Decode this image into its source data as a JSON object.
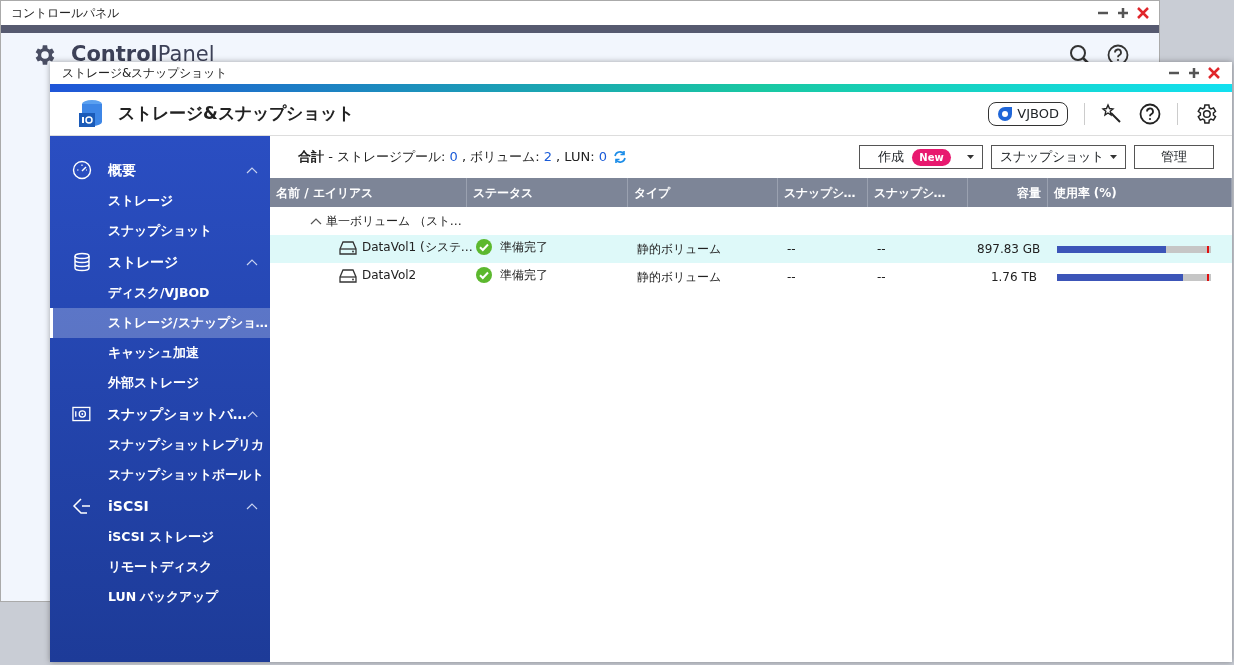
{
  "back_window": {
    "title": "コントロールパネル",
    "app_title_bold": "Control",
    "app_title_light": "Panel"
  },
  "window": {
    "title": "ストレージ&スナップショット",
    "app_title": "ストレージ&スナップショット",
    "vjbod_button": "VJBOD"
  },
  "sidebar": {
    "groups": [
      {
        "label": "概要",
        "kind": "gauge",
        "expanded": true,
        "items": [
          {
            "label": "ストレージ",
            "selected": false
          },
          {
            "label": "スナップショット",
            "selected": false
          }
        ]
      },
      {
        "label": "ストレージ",
        "kind": "database",
        "expanded": true,
        "items": [
          {
            "label": "ディスク/VJBOD",
            "selected": false
          },
          {
            "label": "ストレージ/スナップショ…",
            "selected": true
          },
          {
            "label": "キャッシュ加速",
            "selected": false
          },
          {
            "label": "外部ストレージ",
            "selected": false
          }
        ]
      },
      {
        "label": "スナップショットバ…",
        "kind": "camera",
        "expanded": true,
        "items": [
          {
            "label": "スナップショットレプリカ",
            "selected": false
          },
          {
            "label": "スナップショットボールト",
            "selected": false
          }
        ]
      },
      {
        "label": "iSCSI",
        "kind": "port",
        "expanded": true,
        "items": [
          {
            "label": "iSCSI ストレージ",
            "selected": false
          },
          {
            "label": "リモートディスク",
            "selected": false
          },
          {
            "label": "LUN バックアップ",
            "selected": false
          }
        ]
      }
    ]
  },
  "summary": {
    "label": "合計",
    "stats": [
      {
        "name": "- ストレージプール:",
        "value": "0"
      },
      {
        "name": ", ボリューム:",
        "value": "2"
      },
      {
        "name": ", LUN:",
        "value": "0"
      }
    ]
  },
  "toolbar": {
    "buttons": [
      {
        "label": "作成",
        "badge": "New",
        "dropdown": true
      },
      {
        "label": "スナップショット",
        "dropdown": true
      },
      {
        "label": "管理",
        "dropdown": false
      }
    ]
  },
  "table": {
    "columns": [
      "名前 / エイリアス",
      "ステータス",
      "タイプ",
      "スナップシ…",
      "スナップシ…",
      "容量",
      "使用率 (%)"
    ],
    "groups": [
      {
        "label": "単一ボリューム （スト…",
        "expanded": true,
        "rows": [
          {
            "name": "DataVol1 (システ…",
            "status": "準備完了",
            "type": "静的ボリューム",
            "column_4": "--",
            "column_5": "--",
            "capacity": "897.83 GB",
            "level": 0.71,
            "selected": true
          },
          {
            "name": "DataVol2",
            "status": "準備完了",
            "type": "静的ボリューム",
            "column_4": "--",
            "column_5": "--",
            "capacity": "1.76 TB",
            "level": 0.82,
            "selected": false
          }
        ]
      }
    ]
  }
}
